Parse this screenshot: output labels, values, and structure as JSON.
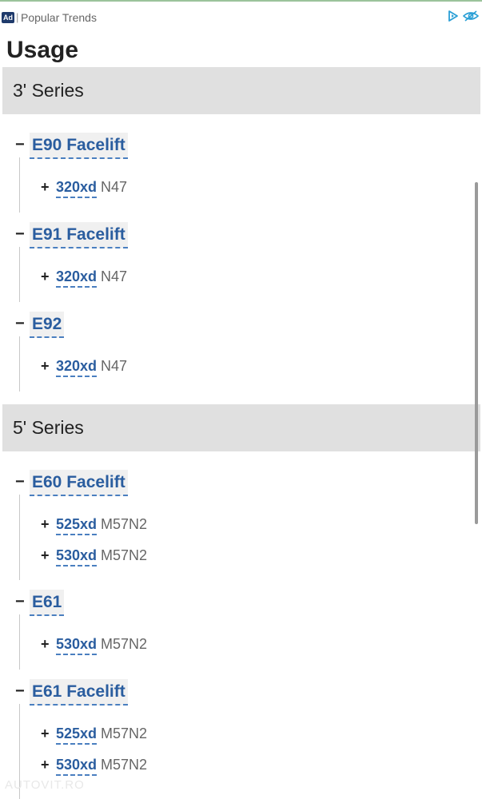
{
  "ad": {
    "badge": "Ad",
    "separator": "|",
    "label": "Popular Trends"
  },
  "title": "Usage",
  "series": [
    {
      "name": "3' Series",
      "models": [
        {
          "name": "E90 Facelift",
          "variants": [
            {
              "code": "320xd",
              "engine": "N47"
            }
          ]
        },
        {
          "name": "E91 Facelift",
          "variants": [
            {
              "code": "320xd",
              "engine": "N47"
            }
          ]
        },
        {
          "name": "E92",
          "variants": [
            {
              "code": "320xd",
              "engine": "N47"
            }
          ]
        }
      ]
    },
    {
      "name": "5' Series",
      "models": [
        {
          "name": "E60 Facelift",
          "variants": [
            {
              "code": "525xd",
              "engine": "M57N2"
            },
            {
              "code": "530xd",
              "engine": "M57N2"
            }
          ]
        },
        {
          "name": "E61",
          "variants": [
            {
              "code": "530xd",
              "engine": "M57N2"
            }
          ]
        },
        {
          "name": "E61 Facelift",
          "variants": [
            {
              "code": "525xd",
              "engine": "M57N2"
            },
            {
              "code": "530xd",
              "engine": "M57N2"
            }
          ]
        }
      ]
    }
  ],
  "symbols": {
    "collapse": "−",
    "expand": "+"
  },
  "watermark": "AUTOVIT.RO"
}
